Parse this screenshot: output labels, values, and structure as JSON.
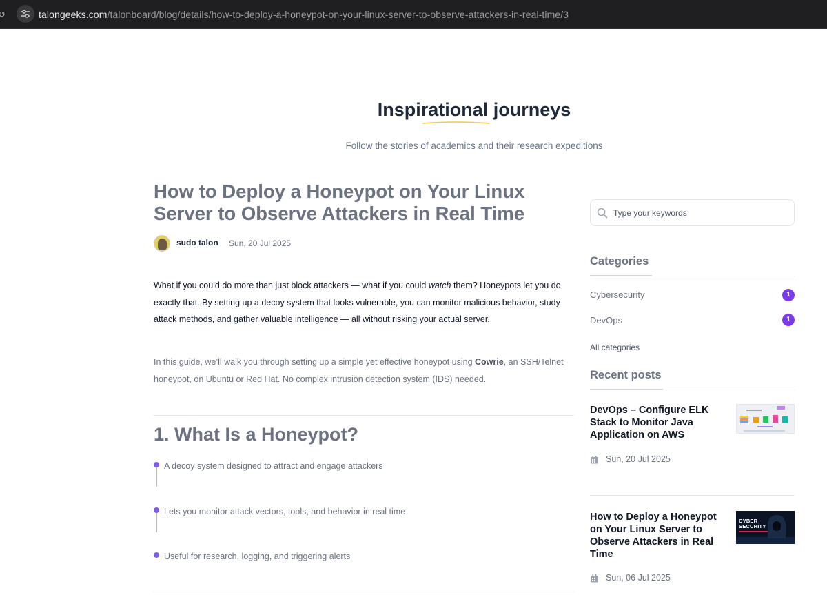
{
  "browser": {
    "url_host": "talongeeks.com",
    "url_path": "/talonboard/blog/details/how-to-deploy-a-honeypot-on-your-linux-server-to-observe-attackers-in-real-time/3"
  },
  "hero": {
    "title": "Inspirational journeys",
    "subtitle": "Follow the stories of academics and their research expeditions"
  },
  "article": {
    "title": "How to Deploy a Honeypot on Your Linux Server to Observe Attackers in Real Time",
    "author": "sudo talon",
    "date": "Sun, 20 Jul 2025",
    "intro_part1": "What if you could do more than just block attackers — what if you could ",
    "intro_em": "watch",
    "intro_part2": " them? Honeypots let you do exactly that. By setting up a decoy system that looks vulnerable, you can monitor malicious behavior, study attack methods, and gather valuable intelligence — all without risking your actual server.",
    "guide_part1": "In this guide, we’ll walk you through setting up a simple yet effective honeypot using ",
    "guide_strong": "Cowrie",
    "guide_part2": ", an SSH/Telnet honeypot, on Ubuntu or Red Hat. No complex intrusion detection system (IDS) needed.",
    "section_title": "1. What Is a Honeypot?",
    "bullets": [
      "A decoy system designed to attract and engage attackers",
      "Lets you monitor attack vectors, tools, and behavior in real time",
      "Useful for research, logging, and triggering alerts"
    ]
  },
  "sidebar": {
    "search_placeholder": "Type your keywords",
    "categories_heading": "Categories",
    "categories": [
      {
        "label": "Cybersecurity",
        "count": "1"
      },
      {
        "label": "DevOps",
        "count": "1"
      }
    ],
    "all_categories": "All categories",
    "recent_heading": "Recent posts",
    "recent_posts": [
      {
        "title": "DevOps – Configure ELK Stack to Monitor Java Application on AWS",
        "date": "Sun, 20 Jul 2025"
      },
      {
        "title": "How to Deploy a Honeypot on Your Linux Server to Observe Attackers in Real Time",
        "date": "Sun, 06 Jul 2025",
        "thumb_text": "CYBER SECURITY"
      }
    ]
  },
  "colors": {
    "accent": "#7c3aed",
    "underline": "#f5c84c",
    "bullet": "#7c5cf0"
  },
  "icons": [
    "site-settings-icon",
    "search-icon",
    "calendar-icon"
  ]
}
